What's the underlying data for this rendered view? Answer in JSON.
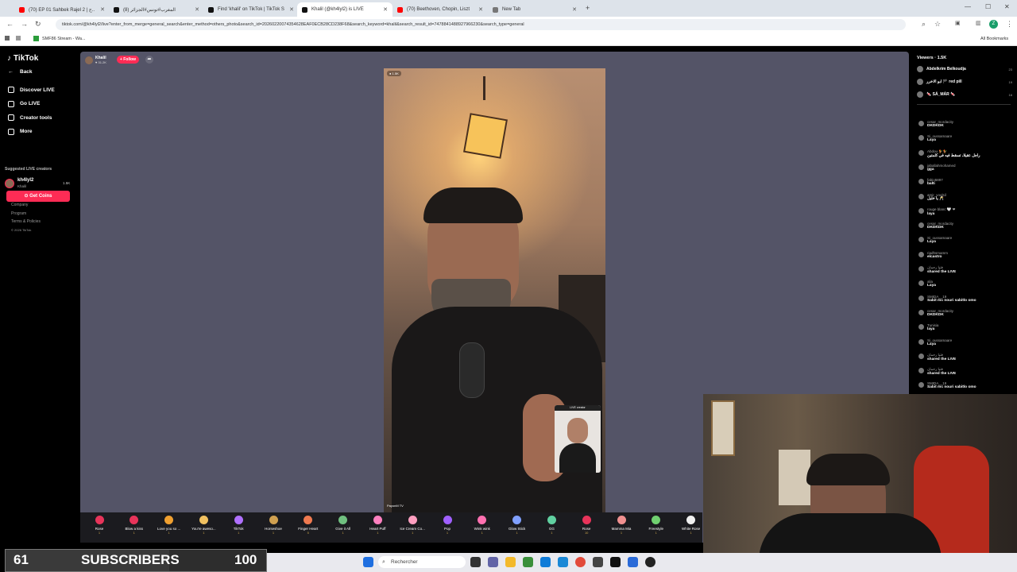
{
  "browser": {
    "tabs": [
      {
        "title": "(70) EP 01 Sahbek Rajel 2 | ج..",
        "color": "#ff0000"
      },
      {
        "title": "المغرب#تونس#الجزائر (8)",
        "color": "#111111"
      },
      {
        "title": "Find 'khalil' on TikTok | TikTok S",
        "color": "#111111"
      },
      {
        "title": "Khalil (@kh4lyl2) is LIVE",
        "color": "#111111",
        "active": true
      },
      {
        "title": "(70) Beethoven, Chopin, Liszt",
        "color": "#ff0000"
      },
      {
        "title": "New Tab",
        "color": "#777777"
      }
    ],
    "url": "tiktok.com/@kh4lyl2/live?enter_from_merge=general_search&enter_method=others_photo&search_id=20260220074354628EAF0ECB28CD238F68&search_keyword=khalil&search_result_id=7478841488927966230&search_type=general",
    "bookmark": "SMF86 Stream - Wa...",
    "all_bookmarks": "All Bookmarks",
    "profile_letter": "Z"
  },
  "sidebar": {
    "logo": "TikTok",
    "back": "Back",
    "nav": [
      "Discover LIVE",
      "Go LIVE",
      "Creator tools",
      "More"
    ],
    "get_coins": "Get Coins",
    "suggested_title": "Suggested LIVE creators",
    "suggested": {
      "name": "kh4lyl2",
      "sub": "Khalil",
      "count": "1.5K"
    },
    "links": [
      "Company",
      "Program",
      "Terms & Policies",
      "© 2026 TikTok"
    ]
  },
  "live": {
    "host_name": "Khalil",
    "host_likes": "♥ 31.2K",
    "follow": "+ Follow",
    "viewer_badge": "● 1.5K",
    "live_creator_label": "LIVE creator",
    "watermark": "PayonM TV"
  },
  "viewers": {
    "title": "Viewers · 1.5K",
    "top": [
      {
        "name": "Abdelkrim Belkoudja",
        "count": "23"
      },
      {
        "name": "ابو الاخرر 🏴 red pill",
        "count": "19"
      },
      {
        "name": "🍬 SÁ_MÁR 🍬",
        "count": "16"
      }
    ]
  },
  "chat": [
    {
      "user": "cesar_mordacity",
      "msg": "DKDKDK"
    },
    {
      "user": "Si_oussamaare",
      "msg": "Laya"
    },
    {
      "user": "Abdou 🐓🐓",
      "msg": "راجل عقيلا، تسقط فيه في كلمتين"
    },
    {
      "user": "jaballahmohamed",
      "msg": "gga"
    },
    {
      "user": "fabio5897",
      "msg": "balti"
    },
    {
      "user": "amir_voulsil",
      "msg": "يا خليل 🥂"
    },
    {
      "user": "rouge blanc 🤍 ❤",
      "msg": "laya"
    },
    {
      "user": "cesar_mordacity",
      "msg": "DKDKDK"
    },
    {
      "user": "Si_oussamaare",
      "msg": "Laya"
    },
    {
      "user": "riadhsmamm",
      "msg": "elcastro"
    },
    {
      "user": "فتيا رحمان",
      "msg": "shared the LIVE"
    },
    {
      "user": "alia",
      "msg": "Laya"
    },
    {
      "user": "SMIDA__19",
      "msg": "Sabit mc nouri sabitlo omo"
    },
    {
      "user": "cesar_mordacity",
      "msg": "DKDKDK"
    },
    {
      "user": "Tunisia",
      "msg": "laya"
    },
    {
      "user": "Si_oussamaare",
      "msg": "Laya"
    },
    {
      "user": "فتيا رحمان",
      "msg": "shared the LIVE"
    },
    {
      "user": "فتيا رحمان",
      "msg": "shared the LIVE"
    },
    {
      "user": "SMIDA__19",
      "msg": "Sabit mc nouri sabitlo omo"
    }
  ],
  "gifts": [
    {
      "name": "Rose",
      "cost": "1",
      "color": "#e8345a"
    },
    {
      "name": "Blow a kiss",
      "cost": "1",
      "color": "#e8345a"
    },
    {
      "name": "Love you so ...",
      "cost": "1",
      "color": "#f0a030"
    },
    {
      "name": "You're aweso...",
      "cost": "1",
      "color": "#f0c060"
    },
    {
      "name": "TikTok",
      "cost": "1",
      "color": "#b070ff"
    },
    {
      "name": "Horseshoe",
      "cost": "1",
      "color": "#d0a050"
    },
    {
      "name": "Finger Heart",
      "cost": "5",
      "color": "#f07a50"
    },
    {
      "name": "Give it All",
      "cost": "1",
      "color": "#70c080"
    },
    {
      "name": "Heart Puff",
      "cost": "1",
      "color": "#ff80c0"
    },
    {
      "name": "Ice Cream Co...",
      "cost": "1",
      "color": "#ff9fc0"
    },
    {
      "name": "Pop",
      "cost": "1",
      "color": "#a060ff"
    },
    {
      "name": "Wink wink",
      "cost": "1",
      "color": "#ff70b0"
    },
    {
      "name": "Glow Stick",
      "cost": "1",
      "color": "#80a0ff"
    },
    {
      "name": "GG",
      "cost": "1",
      "color": "#60d0a0"
    },
    {
      "name": "Rose",
      "cost": "10",
      "color": "#e8345a"
    },
    {
      "name": "Mamma Mia",
      "cost": "1",
      "color": "#f09090"
    },
    {
      "name": "Freestyle",
      "cost": "1",
      "color": "#70d070"
    },
    {
      "name": "White Rose",
      "cost": "1",
      "color": "#f0f0f0"
    }
  ],
  "overlay": {
    "count": "61",
    "label": "SUBSCRIBERS",
    "goal": "100",
    "progress": 0.61
  },
  "taskbar": {
    "search_placeholder": "Rechercher"
  }
}
